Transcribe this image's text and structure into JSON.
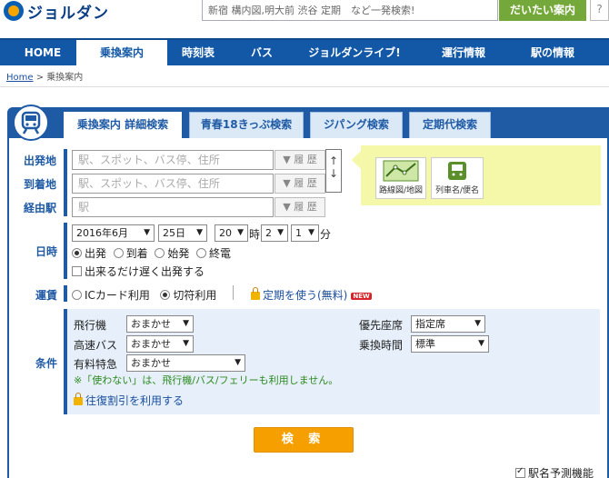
{
  "header": {
    "logo_text": "ジョルダン",
    "search_placeholder": "新宿 構内図,明大前 渋谷 定期　など一発検索!",
    "search_button": "だいたい案内",
    "help_button": "?"
  },
  "nav": {
    "items": [
      "HOME",
      "乗換案内",
      "時刻表",
      "バス",
      "ジョルダンライブ!",
      "運行情報",
      "駅の情報"
    ],
    "active_index": 1
  },
  "breadcrumb": {
    "home": "Home",
    "separator": " > ",
    "current": "乗換案内"
  },
  "tabs": [
    "乗換案内 詳細検索",
    "青春18きっぷ検索",
    "ジパング検索",
    "定期代検索"
  ],
  "form": {
    "from_label": "出発地",
    "to_label": "到着地",
    "via_label": "経由駅",
    "from_placeholder": "駅、スポット、バス停、住所",
    "to_placeholder": "駅、スポット、バス停、住所",
    "via_placeholder": "駅",
    "history_label": "▼ 履 歴",
    "swap_label": "↑↓",
    "map_button": "路線図/地図",
    "train_button": "列車名/便名",
    "datetime_label": "日時",
    "year_month": "2016年6月",
    "day": "25日",
    "hour": "20",
    "hour_suffix": "時",
    "min_tens": "2",
    "min_ones": "1",
    "min_suffix": "分",
    "time_types": [
      "出発",
      "到着",
      "始発",
      "終電"
    ],
    "late_departure": "出来るだけ遅く出発する",
    "fare_label": "運賃",
    "fare_ic": "ICカード利用",
    "fare_ticket": "切符利用",
    "commuter_link": "定期を使う(無料)",
    "new_badge": "NEW",
    "conditions_label": "条件",
    "flight_label": "飛行機",
    "flight_value": "おまかせ",
    "hwbus_label": "高速バス",
    "hwbus_value": "おまかせ",
    "express_label": "有料特急",
    "express_value": "おまかせ",
    "seat_label": "優先座席",
    "seat_value": "指定席",
    "transfer_label": "乗換時間",
    "transfer_value": "標準",
    "note": "※「使わない」は、飛行機/バス/フェリーも利用しません。",
    "roundtrip_link": "往復割引を利用する",
    "submit": "検 索",
    "predict_label": "駅名予測機能"
  },
  "colors": {
    "nav_blue": "#1258a7",
    "accent_orange": "#f5a000",
    "green": "#75a83a"
  }
}
